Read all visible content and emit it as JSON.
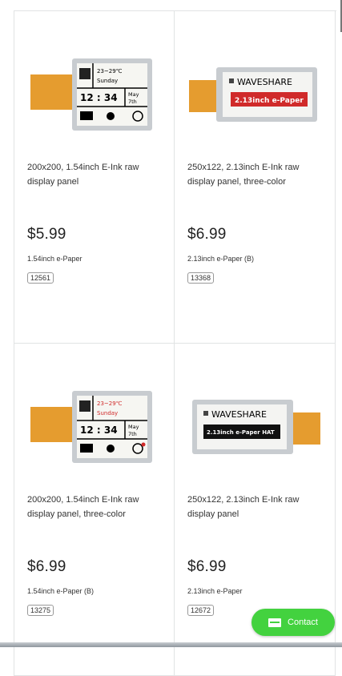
{
  "products": [
    {
      "title": "200x200, 1.54inch E-Ink raw display panel",
      "price": "$5.99",
      "variant": "1.54inch e-Paper",
      "sku": "12561",
      "image": {
        "kind": "clock",
        "accent": "#000000",
        "time": "12 : 34",
        "temp": "23~29℃",
        "day": "Sunday",
        "date_line1": "May",
        "date_line2": "7th"
      }
    },
    {
      "title": "250x122, 2.13inch E-Ink raw display panel, three-color",
      "price": "$6.99",
      "variant": "2.13inch e-Paper (B)",
      "sku": "13368",
      "image": {
        "kind": "banner",
        "brand": "WAVESHARE",
        "caption": "2.13inch e-Paper",
        "caption_bg": "#d02a2a"
      }
    },
    {
      "title": "200x200, 1.54inch E-Ink raw display panel, three-color",
      "price": "$6.99",
      "variant": "1.54inch e-Paper (B)",
      "sku": "13275",
      "image": {
        "kind": "clock",
        "accent": "#d02a2a",
        "time": "12 : 34",
        "temp": "23~29℃",
        "day": "Sunday",
        "date_line1": "May",
        "date_line2": "7th"
      }
    },
    {
      "title": "250x122, 2.13inch E-Ink raw display panel",
      "price": "$6.99",
      "variant": "2.13inch e-Paper",
      "sku": "12672",
      "image": {
        "kind": "banner",
        "brand": "WAVESHARE",
        "caption": "2.13inch e-Paper HAT",
        "caption_bg": "#111111"
      }
    }
  ],
  "contact_button": {
    "label": "Contact",
    "icon": "mail-icon",
    "color": "#43d23f"
  }
}
